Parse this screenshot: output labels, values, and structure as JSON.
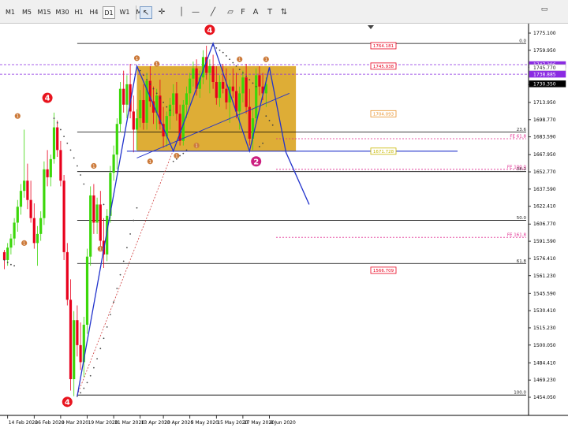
{
  "toolbar": {
    "timeframes": [
      "M1",
      "M5",
      "M15",
      "M30",
      "H1",
      "H4",
      "D1",
      "W1",
      "MN"
    ],
    "active_timeframe": "D1",
    "tools": [
      {
        "icon": "cursor-arrow-icon",
        "glyph": "↖",
        "active": true
      },
      {
        "icon": "crosshair-icon",
        "glyph": "✛",
        "active": false
      },
      {
        "icon": "vertical-line-icon",
        "glyph": "│",
        "active": false
      },
      {
        "icon": "horizontal-line-icon",
        "glyph": "—",
        "active": false
      },
      {
        "icon": "trend-line-icon",
        "glyph": "╱",
        "active": false
      },
      {
        "icon": "equidistant-channel-icon",
        "glyph": "▱",
        "active": false
      },
      {
        "icon": "fibonacci-icon",
        "glyph": "F",
        "active": false
      },
      {
        "icon": "text-icon",
        "glyph": "A",
        "active": false
      },
      {
        "icon": "text-label-icon",
        "glyph": "T",
        "active": false
      },
      {
        "icon": "arrows-icon",
        "glyph": "⇅",
        "active": false
      }
    ],
    "window_icon": "window-icon"
  },
  "colors": {
    "bull": "#3cd70a",
    "bear": "#e8001c",
    "zone": "#daa21a",
    "zigzag": "#2233cc",
    "fib": "#000000",
    "fibext": "#e0298f",
    "psar": "#444444",
    "wave_marker": "#cc7a3a",
    "big_marker": "#e8141e",
    "marker2": "#cc2080"
  },
  "chart_data": {
    "type": "candlestick",
    "ylim": [
      1450,
      1785
    ],
    "price_ticks": [
      "1775.100",
      "1759.950",
      "1744.770",
      "1729.590",
      "1713.950",
      "1698.770",
      "1683.590",
      "1667.950",
      "1652.770",
      "1637.590",
      "1622.410",
      "1606.770",
      "1591.590",
      "1576.410",
      "1561.230",
      "1545.590",
      "1530.410",
      "1515.230",
      "1500.050",
      "1484.410",
      "1469.230",
      "1454.050"
    ],
    "price_tick_values": [
      1775.1,
      1759.95,
      1744.77,
      1729.59,
      1713.95,
      1698.77,
      1683.59,
      1667.95,
      1652.77,
      1637.59,
      1622.41,
      1606.77,
      1591.59,
      1576.41,
      1561.23,
      1545.59,
      1530.41,
      1515.23,
      1500.05,
      1484.41,
      1469.23,
      1454.05
    ],
    "date_labels": [
      "14 Feb 2020",
      "26 Feb 2020",
      "9 Mar 2020",
      "19 Mar 2020",
      "31 Mar 2020",
      "13 Apr 2020",
      "23 Apr 2020",
      "5 May 2020",
      "15 May 2020",
      "27 May 2020",
      "8 Jun 2020"
    ],
    "date_label_index": [
      1,
      9,
      17,
      25,
      33,
      41,
      48,
      56,
      64,
      72,
      80
    ],
    "candles": [
      [
        1582,
        1584,
        1567,
        1575
      ],
      [
        1575,
        1590,
        1570,
        1586
      ],
      [
        1586,
        1598,
        1580,
        1594
      ],
      [
        1594,
        1612,
        1588,
        1608
      ],
      [
        1608,
        1628,
        1600,
        1622
      ],
      [
        1622,
        1642,
        1615,
        1636
      ],
      [
        1636,
        1690,
        1630,
        1645
      ],
      [
        1645,
        1660,
        1620,
        1628
      ],
      [
        1628,
        1645,
        1608,
        1612
      ],
      [
        1612,
        1625,
        1585,
        1590
      ],
      [
        1590,
        1605,
        1570,
        1598
      ],
      [
        1598,
        1618,
        1592,
        1612
      ],
      [
        1612,
        1662,
        1606,
        1655
      ],
      [
        1655,
        1672,
        1640,
        1648
      ],
      [
        1648,
        1668,
        1640,
        1664
      ],
      [
        1664,
        1705,
        1660,
        1692
      ],
      [
        1692,
        1698,
        1666,
        1672
      ],
      [
        1672,
        1680,
        1640,
        1645
      ],
      [
        1645,
        1650,
        1575,
        1582
      ],
      [
        1582,
        1590,
        1535,
        1540
      ],
      [
        1540,
        1558,
        1460,
        1470
      ],
      [
        1470,
        1530,
        1455,
        1522
      ],
      [
        1522,
        1535,
        1490,
        1500
      ],
      [
        1500,
        1520,
        1478,
        1485
      ],
      [
        1485,
        1525,
        1472,
        1518
      ],
      [
        1518,
        1585,
        1510,
        1578
      ],
      [
        1578,
        1640,
        1570,
        1632
      ],
      [
        1632,
        1642,
        1598,
        1608
      ],
      [
        1608,
        1630,
        1598,
        1624
      ],
      [
        1624,
        1636,
        1585,
        1592
      ],
      [
        1592,
        1612,
        1568,
        1580
      ],
      [
        1580,
        1620,
        1574,
        1614
      ],
      [
        1614,
        1658,
        1608,
        1652
      ],
      [
        1652,
        1676,
        1645,
        1668
      ],
      [
        1668,
        1700,
        1655,
        1695
      ],
      [
        1695,
        1732,
        1688,
        1726
      ],
      [
        1726,
        1742,
        1705,
        1712
      ],
      [
        1712,
        1738,
        1700,
        1730
      ],
      [
        1730,
        1748,
        1700,
        1706
      ],
      [
        1706,
        1720,
        1670,
        1690
      ],
      [
        1690,
        1708,
        1672,
        1700
      ],
      [
        1700,
        1725,
        1692,
        1716
      ],
      [
        1716,
        1730,
        1690,
        1696
      ],
      [
        1696,
        1740,
        1690,
        1733
      ],
      [
        1733,
        1746,
        1710,
        1715
      ],
      [
        1715,
        1728,
        1695,
        1705
      ],
      [
        1705,
        1726,
        1690,
        1720
      ],
      [
        1720,
        1734,
        1690,
        1695
      ],
      [
        1695,
        1710,
        1674,
        1684
      ],
      [
        1684,
        1706,
        1675,
        1702
      ],
      [
        1702,
        1718,
        1690,
        1712
      ],
      [
        1712,
        1730,
        1702,
        1722
      ],
      [
        1722,
        1732,
        1698,
        1704
      ],
      [
        1704,
        1712,
        1676,
        1680
      ],
      [
        1680,
        1716,
        1676,
        1712
      ],
      [
        1712,
        1728,
        1700,
        1722
      ],
      [
        1722,
        1740,
        1712,
        1735
      ],
      [
        1735,
        1750,
        1728,
        1744
      ],
      [
        1744,
        1752,
        1720,
        1726
      ],
      [
        1726,
        1742,
        1718,
        1736
      ],
      [
        1736,
        1760,
        1730,
        1754
      ],
      [
        1754,
        1764,
        1734,
        1740
      ],
      [
        1740,
        1752,
        1722,
        1746
      ],
      [
        1746,
        1756,
        1726,
        1732
      ],
      [
        1732,
        1746,
        1712,
        1718
      ],
      [
        1718,
        1738,
        1710,
        1732
      ],
      [
        1732,
        1748,
        1722,
        1726
      ],
      [
        1726,
        1744,
        1708,
        1714
      ],
      [
        1714,
        1734,
        1696,
        1728
      ],
      [
        1728,
        1744,
        1718,
        1724
      ],
      [
        1724,
        1740,
        1700,
        1706
      ],
      [
        1706,
        1728,
        1690,
        1722
      ],
      [
        1722,
        1742,
        1714,
        1736
      ],
      [
        1736,
        1748,
        1704,
        1710
      ],
      [
        1710,
        1726,
        1676,
        1682
      ],
      [
        1682,
        1708,
        1672,
        1700
      ],
      [
        1700,
        1744,
        1695,
        1738
      ],
      [
        1738,
        1746,
        1720,
        1728
      ],
      [
        1728,
        1740,
        1716,
        1722
      ],
      [
        1722,
        1736,
        1710,
        1730
      ]
    ],
    "psar_top": [
      [
        15,
        1700
      ],
      [
        16,
        1696
      ],
      [
        17,
        1690
      ],
      [
        18,
        1684
      ],
      [
        19,
        1678
      ],
      [
        20,
        1672
      ],
      [
        21,
        1665
      ],
      [
        22,
        1658
      ],
      [
        23,
        1650
      ],
      [
        24,
        1642
      ],
      [
        30,
        1624
      ],
      [
        41,
        1742
      ],
      [
        42,
        1738
      ],
      [
        43,
        1734
      ],
      [
        44,
        1730
      ],
      [
        45,
        1726
      ],
      [
        46,
        1722
      ],
      [
        47,
        1718
      ],
      [
        48,
        1714
      ],
      [
        49,
        1710
      ],
      [
        50,
        1707
      ],
      [
        63,
        1764
      ],
      [
        64,
        1762
      ],
      [
        65,
        1760
      ],
      [
        66,
        1758
      ],
      [
        67,
        1755
      ],
      [
        68,
        1752
      ],
      [
        69,
        1749
      ],
      [
        70,
        1746
      ],
      [
        71,
        1743
      ],
      [
        72,
        1740
      ],
      [
        73,
        1737
      ],
      [
        74,
        1734
      ],
      [
        75,
        1731
      ],
      [
        76,
        1728
      ],
      [
        79,
        1702
      ],
      [
        80,
        1698
      ],
      [
        81,
        1694
      ]
    ],
    "psar_bottom": [
      [
        0,
        1575
      ],
      [
        1,
        1573
      ],
      [
        2,
        1571
      ],
      [
        3,
        1570
      ],
      [
        22,
        1455
      ],
      [
        23,
        1458
      ],
      [
        24,
        1462
      ],
      [
        25,
        1467
      ],
      [
        26,
        1473
      ],
      [
        27,
        1480
      ],
      [
        28,
        1488
      ],
      [
        29,
        1497
      ],
      [
        30,
        1506
      ],
      [
        31,
        1516
      ],
      [
        32,
        1527
      ],
      [
        33,
        1538
      ],
      [
        34,
        1550
      ],
      [
        35,
        1562
      ],
      [
        36,
        1574
      ],
      [
        37,
        1586
      ],
      [
        38,
        1598
      ],
      [
        39,
        1610
      ],
      [
        40,
        1621
      ],
      [
        51,
        1662
      ],
      [
        52,
        1664
      ],
      [
        53,
        1667
      ],
      [
        54,
        1669
      ],
      [
        55,
        1672
      ],
      [
        77,
        1675
      ],
      [
        78,
        1678
      ]
    ],
    "zigzag": [
      [
        22,
        1455
      ],
      [
        40,
        1746
      ],
      [
        51,
        1671
      ],
      [
        63,
        1766
      ],
      [
        74,
        1671
      ],
      [
        80,
        1745
      ],
      [
        85,
        1670
      ],
      [
        92,
        1624
      ]
    ],
    "trendline": [
      [
        40,
        1665
      ],
      [
        86,
        1722
      ]
    ],
    "zone": {
      "from_index": 40,
      "to_index": 88,
      "low": 1671,
      "high": 1746
    },
    "fib_levels": [
      {
        "label": "0.0",
        "price": 1766,
        "from": 22
      },
      {
        "label": "23.6",
        "price": 1688,
        "from": 22
      },
      {
        "label": "38.2",
        "price": 1653,
        "from": 22
      },
      {
        "label": "50.0",
        "price": 1610,
        "from": 22
      },
      {
        "label": "61.8",
        "price": 1572,
        "from": 22
      },
      {
        "label": "100.0",
        "price": 1456,
        "from": 22
      }
    ],
    "fib_ext_levels": [
      {
        "label": "FE 61.8",
        "price": 1682
      },
      {
        "label": "FE 100.0",
        "price": 1655
      },
      {
        "label": "FE 161.8",
        "price": 1595
      }
    ],
    "support_line": {
      "price": 1671,
      "from_index": 37
    },
    "dotted_diag": [
      [
        22,
        1456
      ],
      [
        51,
        1672
      ]
    ],
    "price_boxes": [
      {
        "text": "1764.181",
        "price": 1764,
        "color": "#e8001c"
      },
      {
        "text": "1745.938",
        "price": 1746,
        "color": "#e8001c"
      },
      {
        "text": "1704.093",
        "price": 1704,
        "color": "#e8902a"
      },
      {
        "text": "1671.728",
        "price": 1671,
        "color": "#c8b800"
      },
      {
        "text": "1566.709",
        "price": 1566,
        "color": "#e8001c"
      }
    ],
    "right_tags": [
      {
        "text": "1747.296",
        "price": 1747.3,
        "bg": "#8a2be2",
        "fg": "#ffffff"
      },
      {
        "text": "1745.770",
        "price": 1744.6,
        "bg": "#ffffff",
        "fg": "#222222"
      },
      {
        "text": "1738.885",
        "price": 1738.9,
        "bg": "#8a2be2",
        "fg": "#ffffff"
      },
      {
        "text": "1730.350",
        "price": 1730.35,
        "bg": "#000000",
        "fg": "#ffffff"
      }
    ],
    "guide_lines": [
      1747.3,
      1738.9
    ],
    "wave_markers": [
      {
        "text": "1",
        "idx": 4,
        "price": 1702
      },
      {
        "text": "1",
        "idx": 6,
        "price": 1590
      },
      {
        "text": "1",
        "idx": 27,
        "price": 1658
      },
      {
        "text": "1",
        "idx": 40,
        "price": 1753
      },
      {
        "text": "1",
        "idx": 44,
        "price": 1662
      },
      {
        "text": "1",
        "idx": 46,
        "price": 1748
      },
      {
        "text": "1",
        "idx": 52,
        "price": 1667
      },
      {
        "text": "1",
        "idx": 29,
        "price": 1585
      },
      {
        "text": "1",
        "idx": 58,
        "price": 1676
      },
      {
        "text": "1",
        "idx": 71,
        "price": 1752
      },
      {
        "text": "1",
        "idx": 79,
        "price": 1752
      }
    ],
    "big_markers": [
      {
        "text": "4",
        "idx": 13,
        "price": 1718,
        "color": "#e8141e"
      },
      {
        "text": "4",
        "idx": 19,
        "price": 1450,
        "color": "#e8141e"
      },
      {
        "text": "4",
        "idx": 62,
        "price": 1778,
        "color": "#e8141e"
      },
      {
        "text": "2",
        "idx": 76,
        "price": 1662,
        "color": "#cc2080"
      }
    ]
  }
}
